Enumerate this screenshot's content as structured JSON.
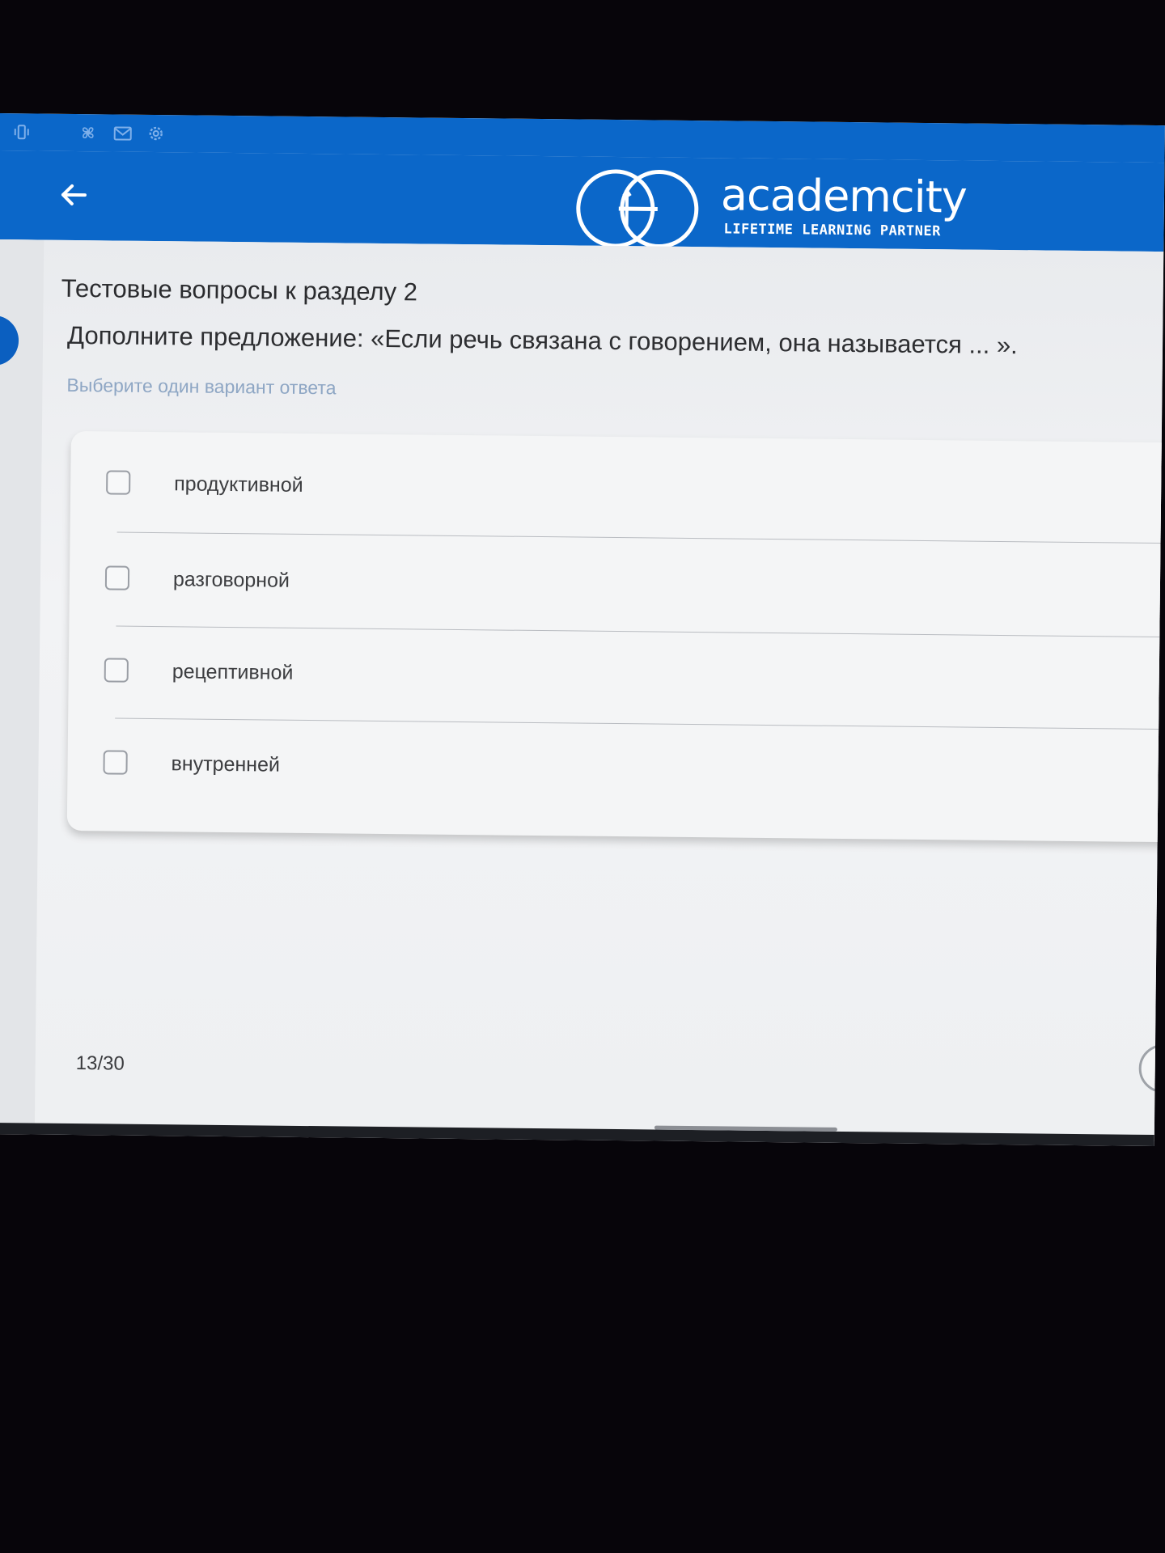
{
  "status_bar": {
    "icons": [
      "vibrate-icon",
      "fan-icon",
      "gmail-icon",
      "settings-icon"
    ]
  },
  "app_bar": {
    "back_icon": "arrow-left-icon",
    "logo": {
      "wordmark": "academcity",
      "tagline": "LIFETIME LEARNING PARTNER"
    }
  },
  "quiz": {
    "section_title": "Тестовые вопросы к разделу 2",
    "question": "Дополните предложение: «Если речь связана с говорением, она называется ... ».",
    "hint": "Выберите один вариант ответа",
    "options": [
      {
        "label": "продуктивной",
        "checked": false
      },
      {
        "label": "разговорной",
        "checked": false
      },
      {
        "label": "рецептивной",
        "checked": false
      },
      {
        "label": "внутренней",
        "checked": false
      }
    ],
    "progress": "13/30"
  },
  "colors": {
    "brand_blue": "#0b67c9",
    "hint_blue": "#8ea6c4",
    "background": "#eceef1"
  }
}
